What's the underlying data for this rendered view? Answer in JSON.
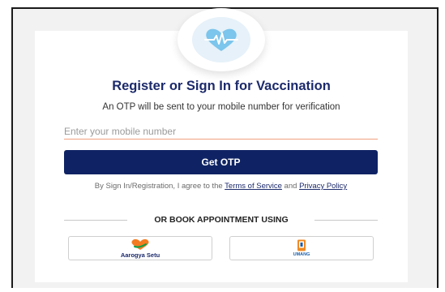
{
  "page": {
    "title": "Register or Sign In for Vaccination",
    "subtitle": "An OTP will be sent to your mobile number for verification"
  },
  "mobile_field": {
    "placeholder": "Enter your mobile number",
    "value": ""
  },
  "get_otp_label": "Get OTP",
  "terms": {
    "prefix": "By Sign In/Registration, I agree to the ",
    "terms_link": "Terms of Service",
    "and": " and ",
    "privacy_link": "Privacy Policy"
  },
  "alternate": {
    "heading": "OR BOOK APPOINTMENT USING",
    "options": [
      {
        "label": "Aarogya Setu",
        "icon": "heart-hand-icon"
      },
      {
        "label": "UMANG",
        "icon": "umang-phone-icon"
      }
    ]
  },
  "colors": {
    "brand_navy": "#0f2364",
    "title_navy": "#1c2a6b",
    "input_underline": "#f0a080",
    "logo_bg": "#e6f1f9",
    "logo_heart": "#7cc5ec",
    "aarogya_orange": "#f47b20",
    "aarogya_green": "#0a9f49",
    "umang_orange": "#f08a24",
    "umang_blue": "#1d5fa8"
  }
}
